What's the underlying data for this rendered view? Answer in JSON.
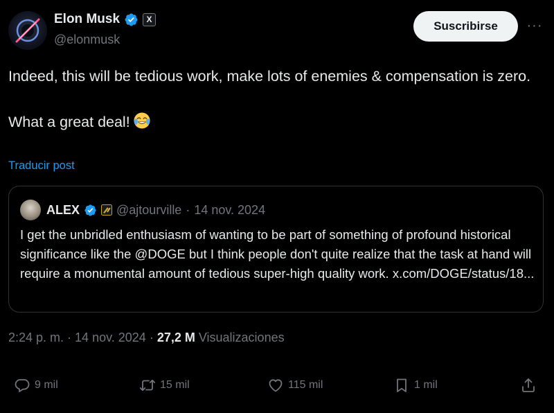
{
  "author": {
    "name": "Elon Musk",
    "handle": "@elonmusk",
    "badge": "X"
  },
  "header": {
    "subscribe_label": "Suscribirse",
    "more_label": "···"
  },
  "post": {
    "line1": "Indeed, this will be tedious work, make lots of enemies & compensation is zero.",
    "line2": "What a great deal!",
    "emoji": "face-with-tears-of-joy",
    "translate_label": "Traducir post"
  },
  "quote": {
    "name": "ALEX",
    "handle": "@ajtourville",
    "separator": "·",
    "date": "14 nov. 2024",
    "text": "I get the unbridled enthusiasm of wanting to be part of something of profound historical significance like the @DOGE but I think people don't quite realize that the task at hand will require a monumental amount of tedious super-high quality work. x.com/DOGE/status/18..."
  },
  "meta": {
    "time": "2:24 p. m.",
    "separator": "·",
    "date": "14 nov. 2024",
    "views_count": "27,2 M",
    "views_label": "Visualizaciones"
  },
  "actions": {
    "replies": "9 mil",
    "reposts": "15 mil",
    "likes": "115 mil",
    "bookmarks": "1 mil"
  },
  "colors": {
    "background": "#000000",
    "text": "#e7e9ea",
    "muted": "#71767b",
    "accent": "#1d9bf0",
    "border": "#2f3336"
  }
}
